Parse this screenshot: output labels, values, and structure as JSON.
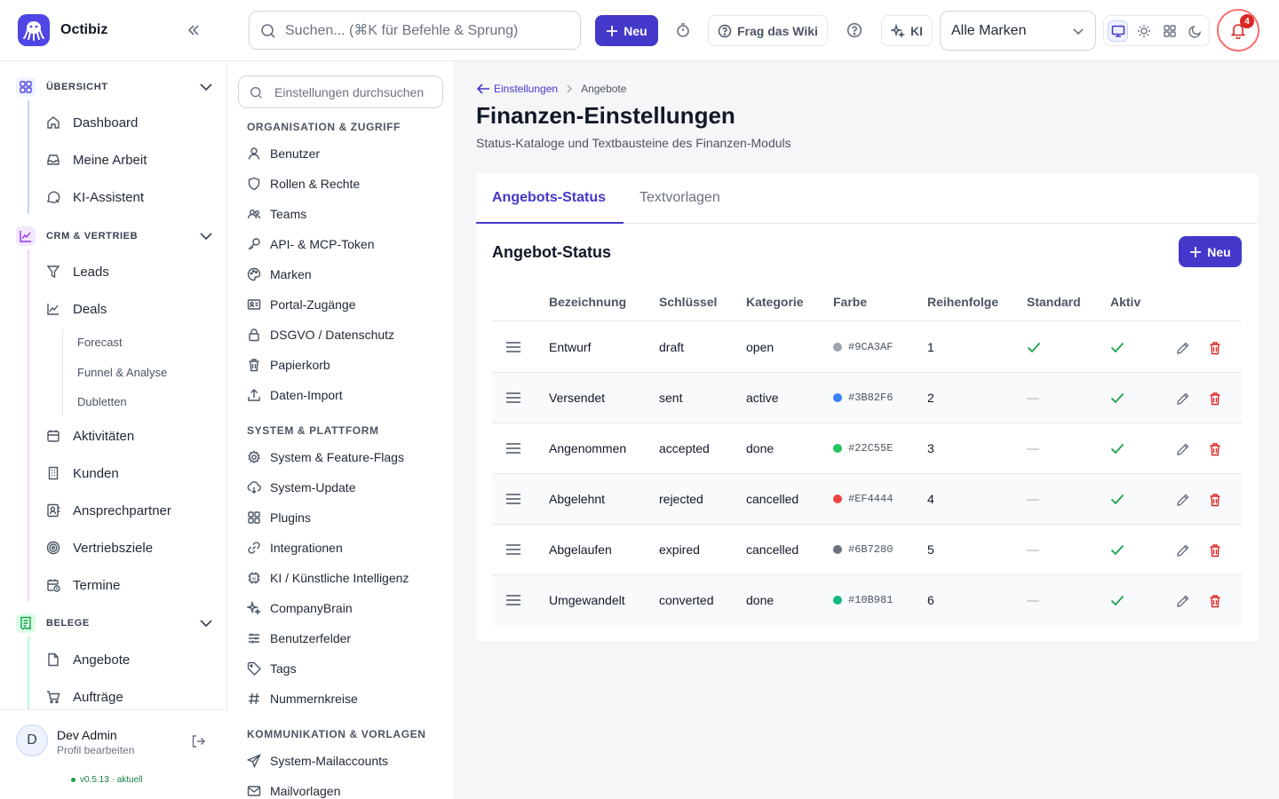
{
  "app": {
    "name": "Octibiz"
  },
  "topbar": {
    "search_placeholder": "Suchen... (⌘K für Befehle & Sprung)",
    "new_label": "Neu",
    "wiki_label": "Frag das Wiki",
    "ki_label": "KI",
    "brand_select": "Alle Marken",
    "notification_count": "4"
  },
  "sidebar": {
    "sections": {
      "overview": "ÜBERSICHT",
      "crm": "CRM & VERTRIEB",
      "belege": "BELEGE"
    },
    "items": {
      "dashboard": "Dashboard",
      "meine_arbeit": "Meine Arbeit",
      "ki_assistent": "KI-Assistent",
      "leads": "Leads",
      "deals": "Deals",
      "forecast": "Forecast",
      "funnel": "Funnel & Analyse",
      "dubletten": "Dubletten",
      "aktivitaeten": "Aktivitäten",
      "kunden": "Kunden",
      "ansprechpartner": "Ansprechpartner",
      "vertriebsziele": "Vertriebsziele",
      "termine": "Termine",
      "angebote": "Angebote",
      "auftraege": "Aufträge"
    },
    "user": {
      "initial": "D",
      "name": "Dev Admin",
      "sub": "Profil bearbeiten",
      "version": "v0.5.13 · aktuell"
    }
  },
  "settings_nav": {
    "search_placeholder": "Einstellungen durchsuchen",
    "groups": {
      "org": "ORGANISATION & ZUGRIFF",
      "system": "SYSTEM & PLATTFORM",
      "komm": "KOMMUNIKATION & VORLAGEN"
    },
    "items": {
      "benutzer": "Benutzer",
      "rollen": "Rollen & Rechte",
      "teams": "Teams",
      "api": "API- & MCP-Token",
      "marken": "Marken",
      "portal": "Portal-Zugänge",
      "dsgvo": "DSGVO / Datenschutz",
      "papierkorb": "Papierkorb",
      "import": "Daten-Import",
      "system_flags": "System & Feature-Flags",
      "update": "System-Update",
      "plugins": "Plugins",
      "integrationen": "Integrationen",
      "ki": "KI / Künstliche Intelligenz",
      "companybrain": "CompanyBrain",
      "benutzerfelder": "Benutzerfelder",
      "tags": "Tags",
      "nummernkreise": "Nummernkreise",
      "mailaccounts": "System-Mailaccounts",
      "mailvorlagen": "Mailvorlagen"
    }
  },
  "main": {
    "breadcrumb_back": "Einstellungen",
    "breadcrumb_current": "Angebote",
    "title": "Finanzen-Einstellungen",
    "subtitle": "Status-Kataloge und Textbausteine des Finanzen-Moduls",
    "tabs": {
      "status": "Angebots-Status",
      "textvorlagen": "Textvorlagen"
    },
    "section_title": "Angebot-Status",
    "new_label": "Neu",
    "columns": {
      "bezeichnung": "Bezeichnung",
      "schluessel": "Schlüssel",
      "kategorie": "Kategorie",
      "farbe": "Farbe",
      "reihenfolge": "Reihenfolge",
      "standard": "Standard",
      "aktiv": "Aktiv"
    },
    "rows": [
      {
        "name": "Entwurf",
        "key": "draft",
        "category": "open",
        "color": "#9CA3AF",
        "order": "1",
        "standard": true,
        "active": true
      },
      {
        "name": "Versendet",
        "key": "sent",
        "category": "active",
        "color": "#3B82F6",
        "order": "2",
        "standard": false,
        "active": true
      },
      {
        "name": "Angenommen",
        "key": "accepted",
        "category": "done",
        "color": "#22C55E",
        "order": "3",
        "standard": false,
        "active": true
      },
      {
        "name": "Abgelehnt",
        "key": "rejected",
        "category": "cancelled",
        "color": "#EF4444",
        "order": "4",
        "standard": false,
        "active": true
      },
      {
        "name": "Abgelaufen",
        "key": "expired",
        "category": "cancelled",
        "color": "#6B7280",
        "order": "5",
        "standard": false,
        "active": true
      },
      {
        "name": "Umgewandelt",
        "key": "converted",
        "category": "done",
        "color": "#10B981",
        "order": "6",
        "standard": false,
        "active": true
      }
    ]
  },
  "colors": {
    "accent": "#4338ca",
    "success": "#16a34a",
    "danger": "#dc2626"
  }
}
